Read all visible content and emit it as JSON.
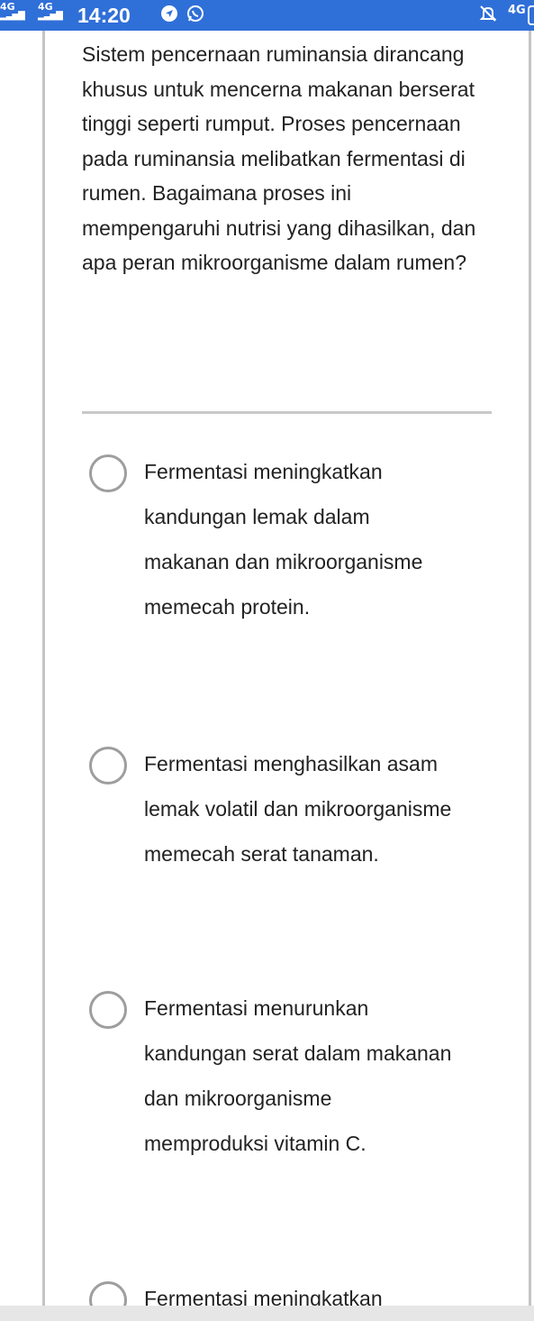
{
  "status_bar": {
    "network_left_1": "4G",
    "network_left_2": "4G",
    "time": "14:20",
    "network_right": "4G",
    "icons": [
      "signal-bars-icon",
      "signal-bars-icon",
      "location-arrow-icon",
      "whatsapp-icon",
      "mute-bell-icon",
      "battery-icon"
    ],
    "background_color": "#2f6fd8"
  },
  "question": {
    "text": "Sistem pencernaan ruminansia dirancang khusus untuk mencerna makanan berserat tinggi seperti rumput. Proses pencernaan pada ruminansia melibatkan fermentasi di rumen. Bagaimana proses ini mempengaruhi nutrisi yang dihasilkan, dan apa peran mikroorganisme dalam rumen?"
  },
  "options": [
    {
      "label": "Fermentasi meningkatkan kandungan lemak dalam makanan dan mikroorganisme memecah protein.",
      "selected": false
    },
    {
      "label": "Fermentasi menghasilkan asam lemak volatil dan mikroorganisme memecah serat tanaman.",
      "selected": false
    },
    {
      "label": "Fermentasi menurunkan kandungan serat dalam makanan dan mikroorganisme memproduksi vitamin C.",
      "selected": false
    },
    {
      "label": "Fermentasi meningkatkan",
      "selected": false
    }
  ]
}
